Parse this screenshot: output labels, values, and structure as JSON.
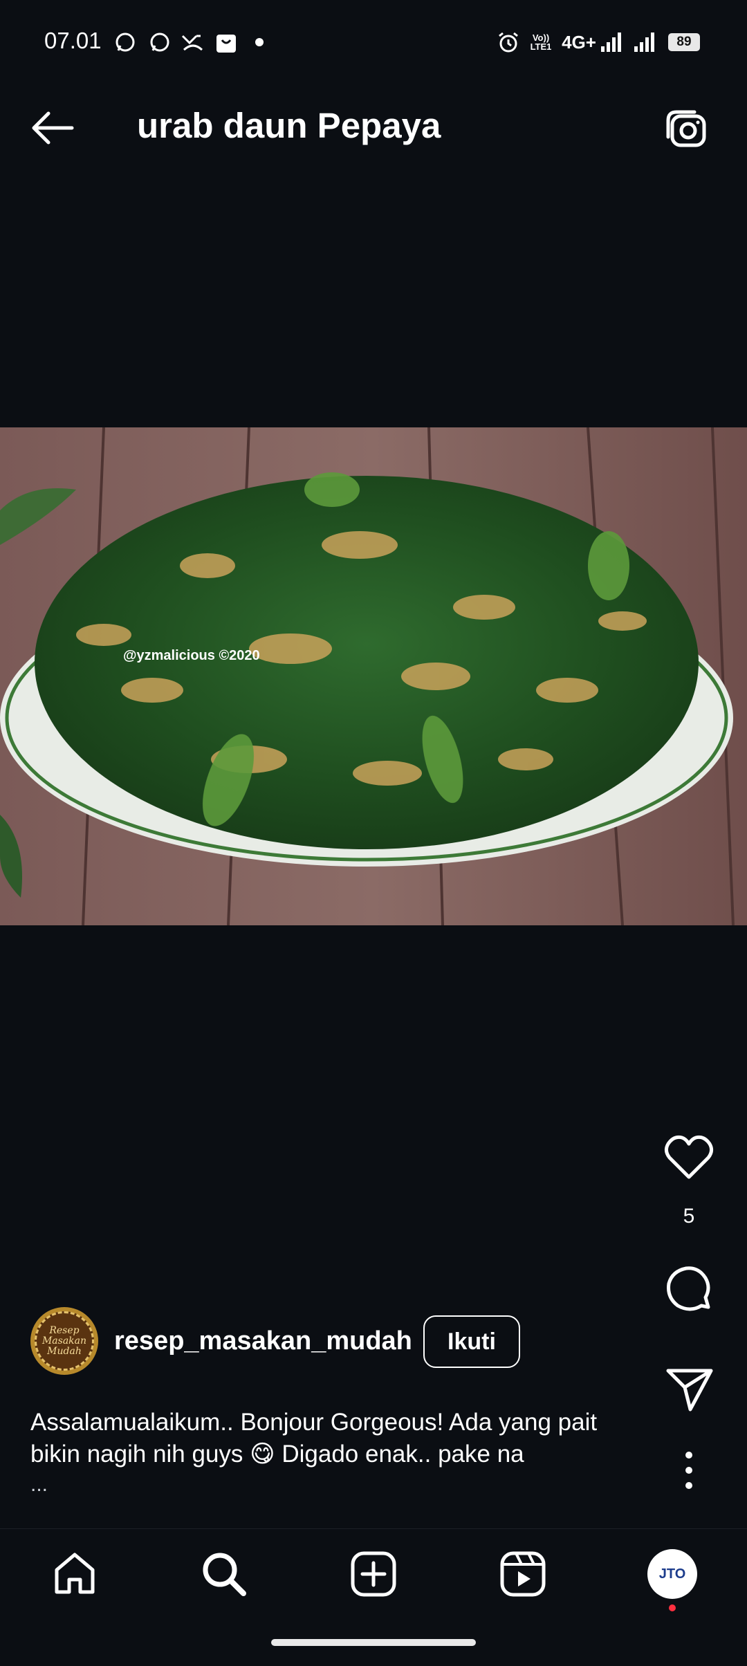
{
  "status_bar": {
    "time": "07.01",
    "network": "4G+",
    "battery": "89",
    "icons": [
      "whatsapp-icon",
      "whatsapp-icon",
      "missed-call-icon",
      "shopping-bag-icon",
      "dot-icon",
      "alarm-icon",
      "volte-icon",
      "signal-icon",
      "signal-icon",
      "battery-icon"
    ]
  },
  "header": {
    "title": "urab daun Pepaya"
  },
  "post": {
    "watermark": "@yzmalicious ©2020",
    "likes": "5",
    "author": {
      "username": "resep_masakan_mudah",
      "avatar_text": "Resep Masakan Mudah"
    },
    "follow_label": "Ikuti",
    "caption": "Assalamualaikum.. Bonjour Gorgeous! Ada yang pait bikin nagih nih guys 😋 Digado enak.. pake na",
    "caption_more": "..."
  },
  "nav": {
    "items": [
      "home-icon",
      "search-icon",
      "add-icon",
      "reels-icon",
      "profile-avatar"
    ],
    "profile_logo": "JTO"
  },
  "colors": {
    "background": "#0b0e13",
    "text": "#ffffff",
    "notification": "#ff3040"
  }
}
